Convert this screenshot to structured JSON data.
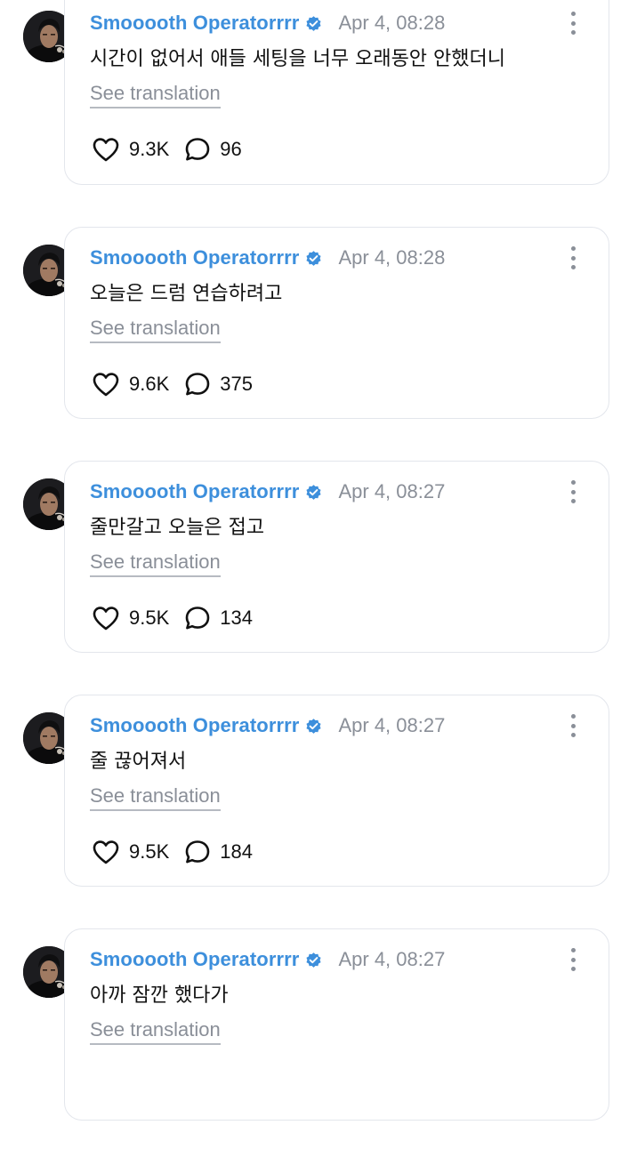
{
  "author": {
    "name": "Smooooth Operatorrrr",
    "verified": true
  },
  "colors": {
    "author": "#3d8fdc",
    "verified_badge": "#3d8fdc",
    "muted": "#8a8f98",
    "card_border": "#e3e6ec"
  },
  "posts": [
    {
      "timestamp": "Apr 4, 08:28",
      "text": "시간이 없어서 애들 세팅을 너무 오래동안 안했더니",
      "translate_label": "See translation",
      "likes": "9.3K",
      "replies": "96"
    },
    {
      "timestamp": "Apr 4, 08:28",
      "text": "오늘은 드럼 연습하려고",
      "translate_label": "See translation",
      "likes": "9.6K",
      "replies": "375"
    },
    {
      "timestamp": "Apr 4, 08:27",
      "text": "줄만갈고 오늘은 접고",
      "translate_label": "See translation",
      "likes": "9.5K",
      "replies": "134"
    },
    {
      "timestamp": "Apr 4, 08:27",
      "text": "줄 끊어져서",
      "translate_label": "See translation",
      "likes": "9.5K",
      "replies": "184"
    },
    {
      "timestamp": "Apr 4, 08:27",
      "text": "아까 잠깐 했다가",
      "translate_label": "See translation",
      "likes": "",
      "replies": ""
    }
  ]
}
